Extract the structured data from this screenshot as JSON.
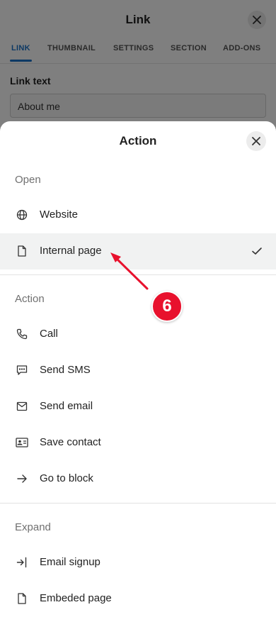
{
  "background_dialog": {
    "title": "Link",
    "tabs": [
      {
        "label": "LINK",
        "active": true
      },
      {
        "label": "THUMBNAIL",
        "active": false
      },
      {
        "label": "SETTINGS",
        "active": false
      },
      {
        "label": "SECTION",
        "active": false
      },
      {
        "label": "ADD-ONS",
        "active": false
      }
    ],
    "field_label": "Link text",
    "field_value": "About me"
  },
  "sheet": {
    "title": "Action",
    "sections": [
      {
        "label": "Open",
        "items": [
          {
            "label": "Website",
            "icon": "globe-icon",
            "selected": false
          },
          {
            "label": "Internal page",
            "icon": "document-icon",
            "selected": true
          }
        ]
      },
      {
        "label": "Action",
        "items": [
          {
            "label": "Call",
            "icon": "phone-icon",
            "selected": false
          },
          {
            "label": "Send SMS",
            "icon": "chat-icon",
            "selected": false
          },
          {
            "label": "Send email",
            "icon": "mail-icon",
            "selected": false
          },
          {
            "label": "Save contact",
            "icon": "contact-card-icon",
            "selected": false
          },
          {
            "label": "Go to block",
            "icon": "arrow-right-icon",
            "selected": false
          }
        ]
      },
      {
        "label": "Expand",
        "items": [
          {
            "label": "Email signup",
            "icon": "sign-in-icon",
            "selected": false
          },
          {
            "label": "Embeded page",
            "icon": "document-icon",
            "selected": false
          }
        ]
      }
    ]
  },
  "annotation": {
    "step_number": "6",
    "color": "#e8112d"
  },
  "colors": {
    "accent": "#1a73c9",
    "selected_row": "#f1f2f2",
    "section_label": "#707070"
  }
}
